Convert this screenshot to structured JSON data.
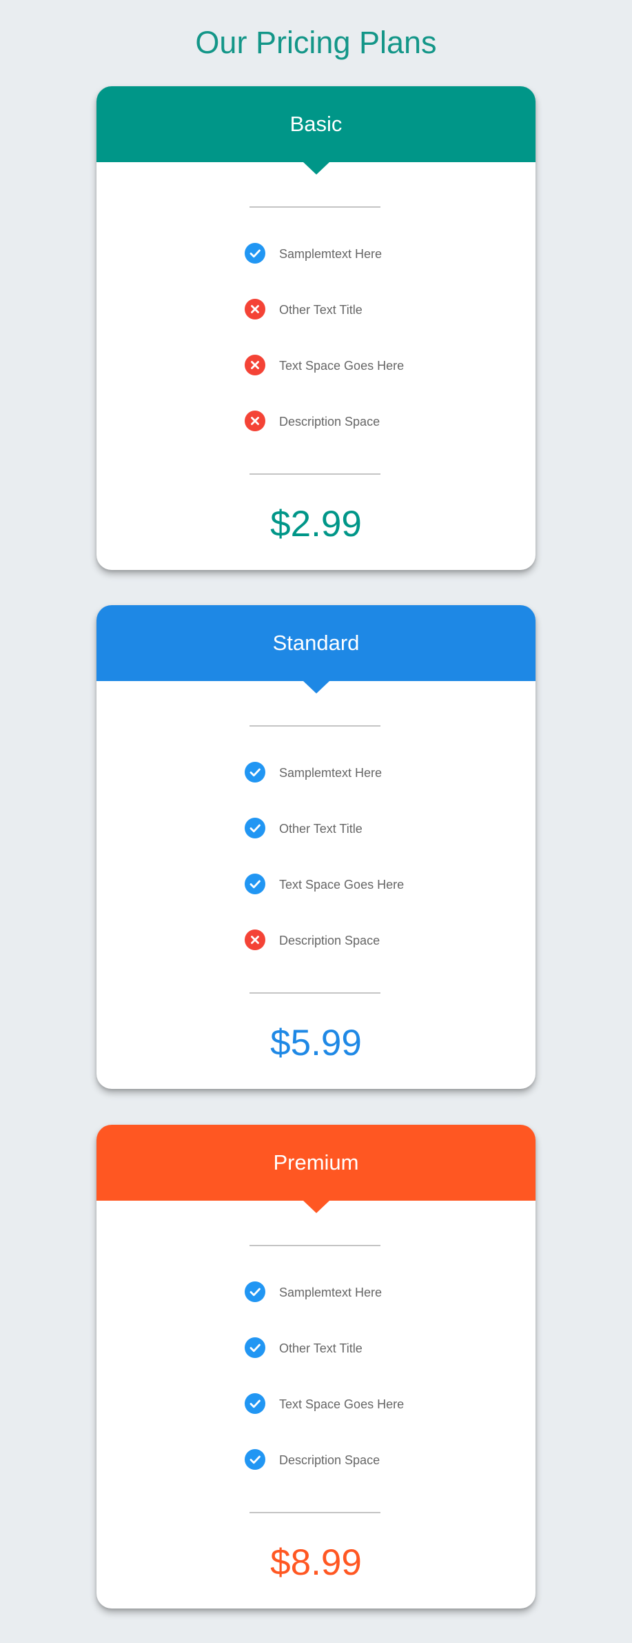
{
  "page": {
    "title": "Our Pricing Plans",
    "title_color": "#139688"
  },
  "icons": {
    "included": "check-icon",
    "excluded": "close-icon",
    "included_color": "#2196f3",
    "excluded_color": "#f44336"
  },
  "plans": [
    {
      "name": "Basic",
      "price": "$2.99",
      "color": "#009688",
      "features": [
        {
          "label": "Samplemtext Here",
          "included": true
        },
        {
          "label": "Other Text Title",
          "included": false
        },
        {
          "label": "Text Space Goes Here",
          "included": false
        },
        {
          "label": "Description Space",
          "included": false
        }
      ]
    },
    {
      "name": "Standard",
      "price": "$5.99",
      "color": "#1e88e5",
      "features": [
        {
          "label": "Samplemtext Here",
          "included": true
        },
        {
          "label": "Other Text Title",
          "included": true
        },
        {
          "label": "Text Space Goes Here",
          "included": true
        },
        {
          "label": "Description Space",
          "included": false
        }
      ]
    },
    {
      "name": "Premium",
      "price": "$8.99",
      "color": "#ff5722",
      "features": [
        {
          "label": "Samplemtext Here",
          "included": true
        },
        {
          "label": "Other Text Title",
          "included": true
        },
        {
          "label": "Text Space Goes Here",
          "included": true
        },
        {
          "label": "Description Space",
          "included": true
        }
      ]
    }
  ]
}
